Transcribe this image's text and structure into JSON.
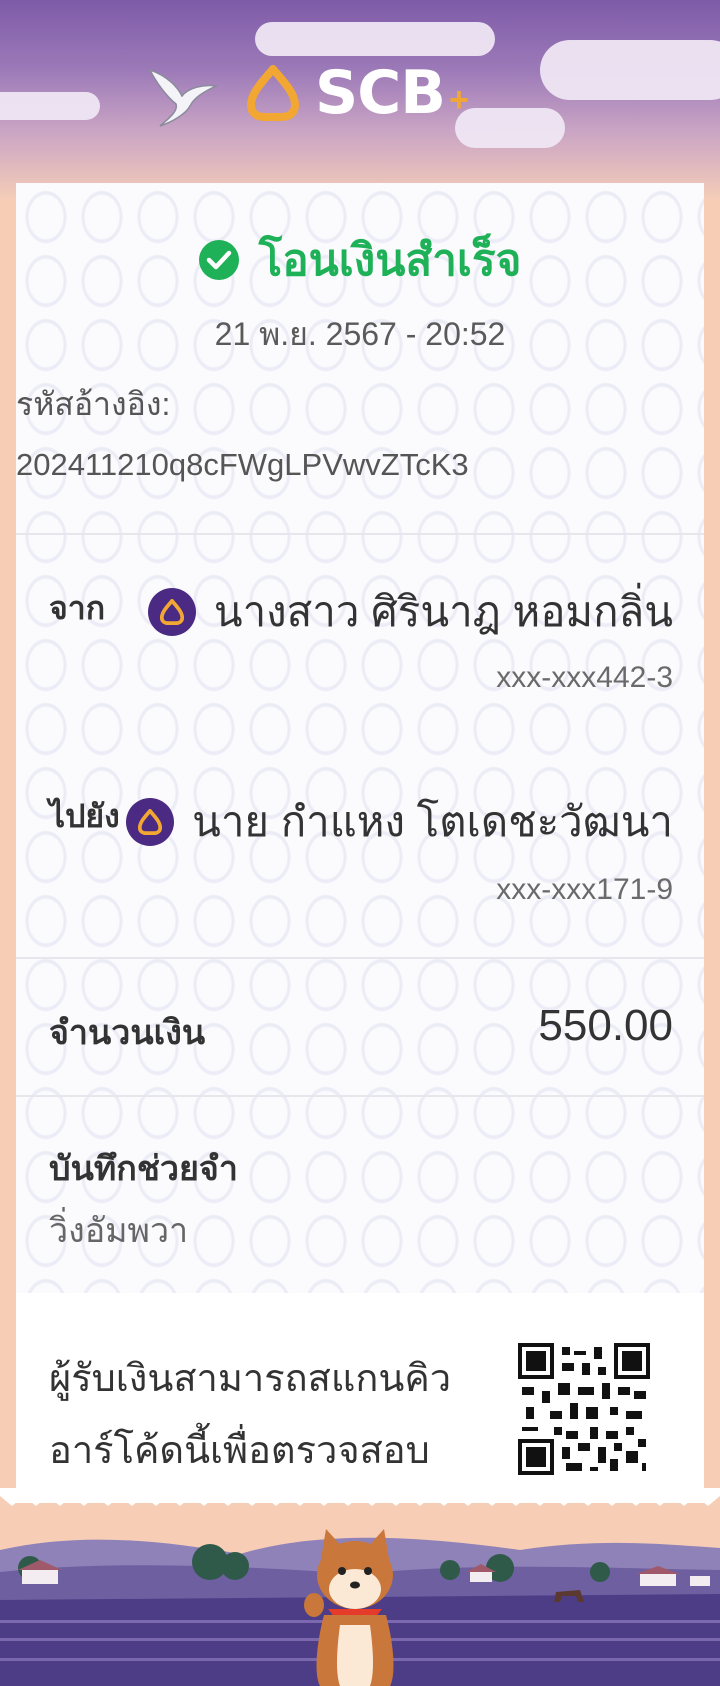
{
  "brand": {
    "name": "SCB",
    "plus": "+"
  },
  "status": {
    "text": "โอนเงินสำเร็จ",
    "color": "#1fb158"
  },
  "datetime": "21 พ.ย. 2567 - 20:52",
  "reference": {
    "label": "รหัสอ้างอิง:",
    "value": "202411210q8cFWgLPVwvZTcK3"
  },
  "from": {
    "label": "จาก",
    "name": "นางสาว ศิรินาฎ หอมกลิ่น",
    "account": "xxx-xxx442-3",
    "bank_icon": "scb-bank-icon"
  },
  "to": {
    "label": "ไปยัง",
    "name": "นาย กำแหง โตเดชะวัฒนา",
    "account": "xxx-xxx171-9",
    "bank_icon": "scb-bank-icon"
  },
  "amount": {
    "label": "จำนวนเงิน",
    "value": "550.00"
  },
  "memo": {
    "label": "บันทึกช่วยจำ",
    "value": "วิ่งอัมพวา"
  },
  "qr": {
    "text": "ผู้รับเงินสามารถสแกนคิวอาร์โค้ดนี้เพื่อตรวจสอบ"
  },
  "colors": {
    "brand_purple": "#4a2a82",
    "brand_gold": "#f2a733",
    "success_green": "#1fb158"
  }
}
